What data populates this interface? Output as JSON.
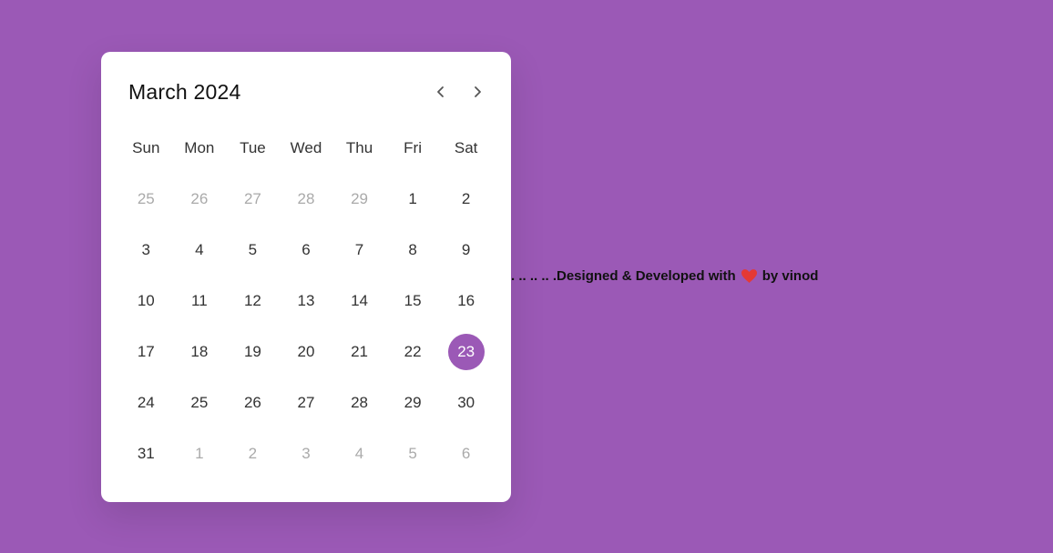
{
  "calendar": {
    "month_title": "March 2024",
    "weekdays": [
      "Sun",
      "Mon",
      "Tue",
      "Wed",
      "Thu",
      "Fri",
      "Sat"
    ],
    "days": [
      {
        "label": "25",
        "inactive": true
      },
      {
        "label": "26",
        "inactive": true
      },
      {
        "label": "27",
        "inactive": true
      },
      {
        "label": "28",
        "inactive": true
      },
      {
        "label": "29",
        "inactive": true
      },
      {
        "label": "1"
      },
      {
        "label": "2"
      },
      {
        "label": "3"
      },
      {
        "label": "4"
      },
      {
        "label": "5"
      },
      {
        "label": "6"
      },
      {
        "label": "7"
      },
      {
        "label": "8"
      },
      {
        "label": "9"
      },
      {
        "label": "10"
      },
      {
        "label": "11"
      },
      {
        "label": "12"
      },
      {
        "label": "13"
      },
      {
        "label": "14"
      },
      {
        "label": "15"
      },
      {
        "label": "16"
      },
      {
        "label": "17"
      },
      {
        "label": "18"
      },
      {
        "label": "19"
      },
      {
        "label": "20"
      },
      {
        "label": "21"
      },
      {
        "label": "22"
      },
      {
        "label": "23",
        "active": true
      },
      {
        "label": "24"
      },
      {
        "label": "25"
      },
      {
        "label": "26"
      },
      {
        "label": "27"
      },
      {
        "label": "28"
      },
      {
        "label": "29"
      },
      {
        "label": "30"
      },
      {
        "label": "31"
      },
      {
        "label": "1",
        "inactive": true
      },
      {
        "label": "2",
        "inactive": true
      },
      {
        "label": "3",
        "inactive": true
      },
      {
        "label": "4",
        "inactive": true
      },
      {
        "label": "5",
        "inactive": true
      },
      {
        "label": "6",
        "inactive": true
      }
    ],
    "prev_icon": "chevron-left-icon",
    "next_icon": "chevron-right-icon"
  },
  "footer": {
    "prefix": ". .. .. .. .Designed & Developed with",
    "heart_icon": "heart-icon",
    "suffix": "by vinod"
  },
  "colors": {
    "background": "#9b59b6",
    "accent": "#9b59b6",
    "card": "#ffffff",
    "heart": "#e53935"
  }
}
